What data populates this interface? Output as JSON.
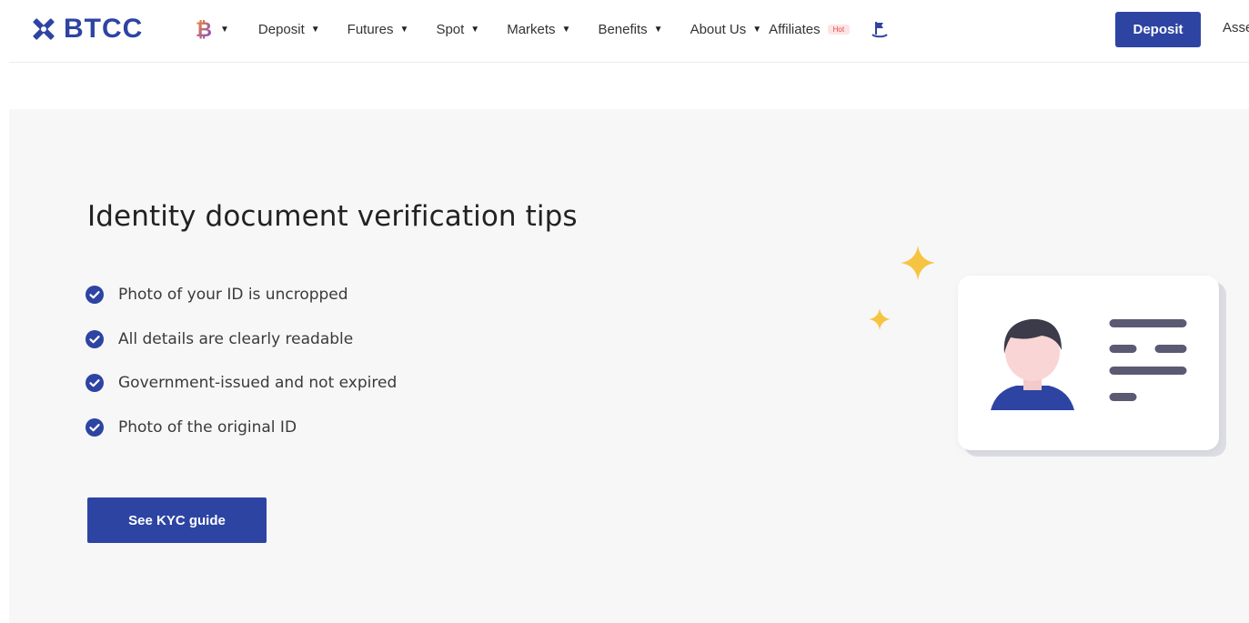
{
  "header": {
    "brand": "BTCC",
    "nav": [
      {
        "label": "Deposit"
      },
      {
        "label": "Futures"
      },
      {
        "label": "Spot"
      },
      {
        "label": "Markets"
      },
      {
        "label": "Benefits"
      },
      {
        "label": "About Us"
      }
    ],
    "affiliates_label": "Affiliates",
    "hot_badge": "Hot",
    "deposit_button": "Deposit",
    "assets_label": "Asse"
  },
  "main": {
    "title": "Identity document verification tips",
    "tips": [
      "Photo of your ID is uncropped",
      "All details are clearly readable",
      "Government-issued and not expired",
      "Photo of the original ID"
    ],
    "kyc_button": "See KYC guide"
  },
  "colors": {
    "brand_blue": "#2d44a3",
    "panel_bg": "#f7f7f8",
    "sparkle": "#f5c542",
    "hot_red": "#e24b4b"
  },
  "icons": [
    "btcc-logo-icon",
    "bitcoin-icon",
    "caret-down-icon",
    "flag-icon",
    "check-circle-icon",
    "sparkle-icon",
    "avatar-icon"
  ]
}
